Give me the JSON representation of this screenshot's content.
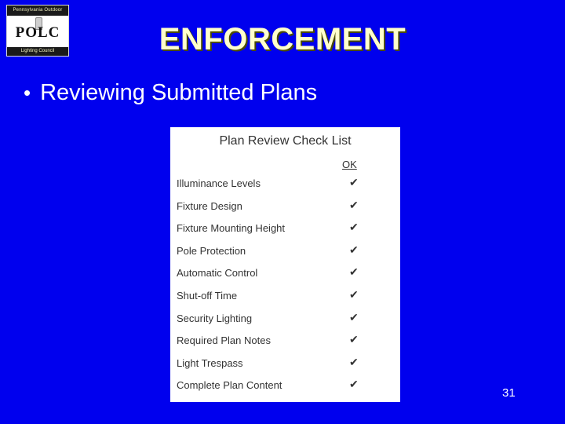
{
  "logo": {
    "top_text": "Pennsylvania Outdoor",
    "center_text": "POLC",
    "bottom_text": "Lighting Council"
  },
  "slide": {
    "title": "ENFORCEMENT",
    "bullet": {
      "marker": "•",
      "text": "Reviewing Submitted Plans"
    },
    "page_number": "31"
  },
  "checklist": {
    "title": "Plan Review Check List",
    "ok_header": "OK",
    "check_mark": "✔",
    "items": [
      {
        "label": "Illuminance Levels",
        "ok": "✔"
      },
      {
        "label": "Fixture Design",
        "ok": "✔"
      },
      {
        "label": "Fixture Mounting Height",
        "ok": "✔"
      },
      {
        "label": "Pole Protection",
        "ok": "✔"
      },
      {
        "label": "Automatic Control",
        "ok": "✔"
      },
      {
        "label": "Shut-off Time",
        "ok": "✔"
      },
      {
        "label": "Security Lighting",
        "ok": "✔"
      },
      {
        "label": "Required Plan Notes",
        "ok": "✔"
      },
      {
        "label": "Light Trespass",
        "ok": "✔"
      },
      {
        "label": "Complete Plan Content",
        "ok": "✔"
      }
    ]
  },
  "colors": {
    "background": "#0000ee",
    "title": "#ffffcc",
    "body_text": "#ffffff",
    "panel": "#ffffff"
  }
}
